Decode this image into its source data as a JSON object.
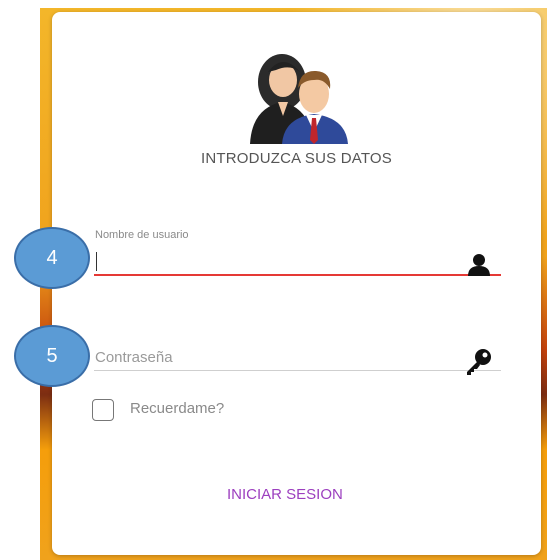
{
  "form": {
    "heading": "INTRODUZCA SUS DATOS",
    "username": {
      "label": "Nombre de usuario",
      "value": "",
      "icon": "user-icon"
    },
    "password": {
      "placeholder": "Contraseña",
      "icon": "key-icon"
    },
    "remember": {
      "label": "Recuerdame?",
      "checked": false
    },
    "submit_label": "INICIAR SESION"
  },
  "annotations": [
    {
      "label": "4"
    },
    {
      "label": "5"
    }
  ],
  "colors": {
    "accent_underline": "#e53935",
    "submit_text": "#9c3fbf",
    "annotation_fill": "#5b9bd5"
  }
}
